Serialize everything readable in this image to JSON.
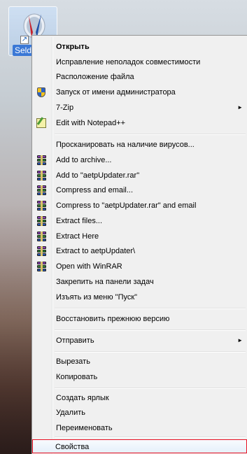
{
  "desktop": {
    "shortcut_label": "Seldo"
  },
  "menu": {
    "items": [
      {
        "id": "open",
        "label": "Открыть",
        "bold": true
      },
      {
        "id": "troubleshoot",
        "label": "Исправление неполадок совместимости"
      },
      {
        "id": "file-location",
        "label": "Расположение файла"
      },
      {
        "id": "run-as-admin",
        "label": "Запуск от имени администратора",
        "icon": "uac-shield-icon"
      },
      {
        "id": "7zip",
        "label": "7-Zip",
        "submenu": true
      },
      {
        "id": "notepadpp",
        "label": "Edit with Notepad++",
        "icon": "notepadpp-icon"
      },
      {
        "id": "scan",
        "label": "Просканировать на наличие вирусов..."
      },
      {
        "id": "add-archive",
        "label": "Add to archive...",
        "icon": "winrar-icon"
      },
      {
        "id": "add-rar",
        "label": "Add to \"aetpUpdater.rar\"",
        "icon": "winrar-icon"
      },
      {
        "id": "compress-email",
        "label": "Compress and email...",
        "icon": "winrar-icon"
      },
      {
        "id": "compress-rar-email",
        "label": "Compress to \"aetpUpdater.rar\" and email",
        "icon": "winrar-icon"
      },
      {
        "id": "extract-files",
        "label": "Extract files...",
        "icon": "winrar-icon"
      },
      {
        "id": "extract-here",
        "label": "Extract Here",
        "icon": "winrar-icon"
      },
      {
        "id": "extract-to",
        "label": "Extract to aetpUpdater\\",
        "icon": "winrar-icon"
      },
      {
        "id": "open-winrar",
        "label": "Open with WinRAR",
        "icon": "winrar-icon"
      },
      {
        "id": "pin-taskbar",
        "label": "Закрепить на панели задач"
      },
      {
        "id": "unpin-start",
        "label": "Изъять из меню \"Пуск\""
      },
      {
        "id": "restore",
        "label": "Восстановить прежнюю версию"
      },
      {
        "id": "send-to",
        "label": "Отправить",
        "submenu": true
      },
      {
        "id": "cut",
        "label": "Вырезать"
      },
      {
        "id": "copy",
        "label": "Копировать"
      },
      {
        "id": "create-shortcut",
        "label": "Создать ярлык"
      },
      {
        "id": "delete",
        "label": "Удалить"
      },
      {
        "id": "rename",
        "label": "Переименовать"
      },
      {
        "id": "properties",
        "label": "Свойства",
        "highlighted": true
      }
    ],
    "highlight_color": "#e81123"
  }
}
